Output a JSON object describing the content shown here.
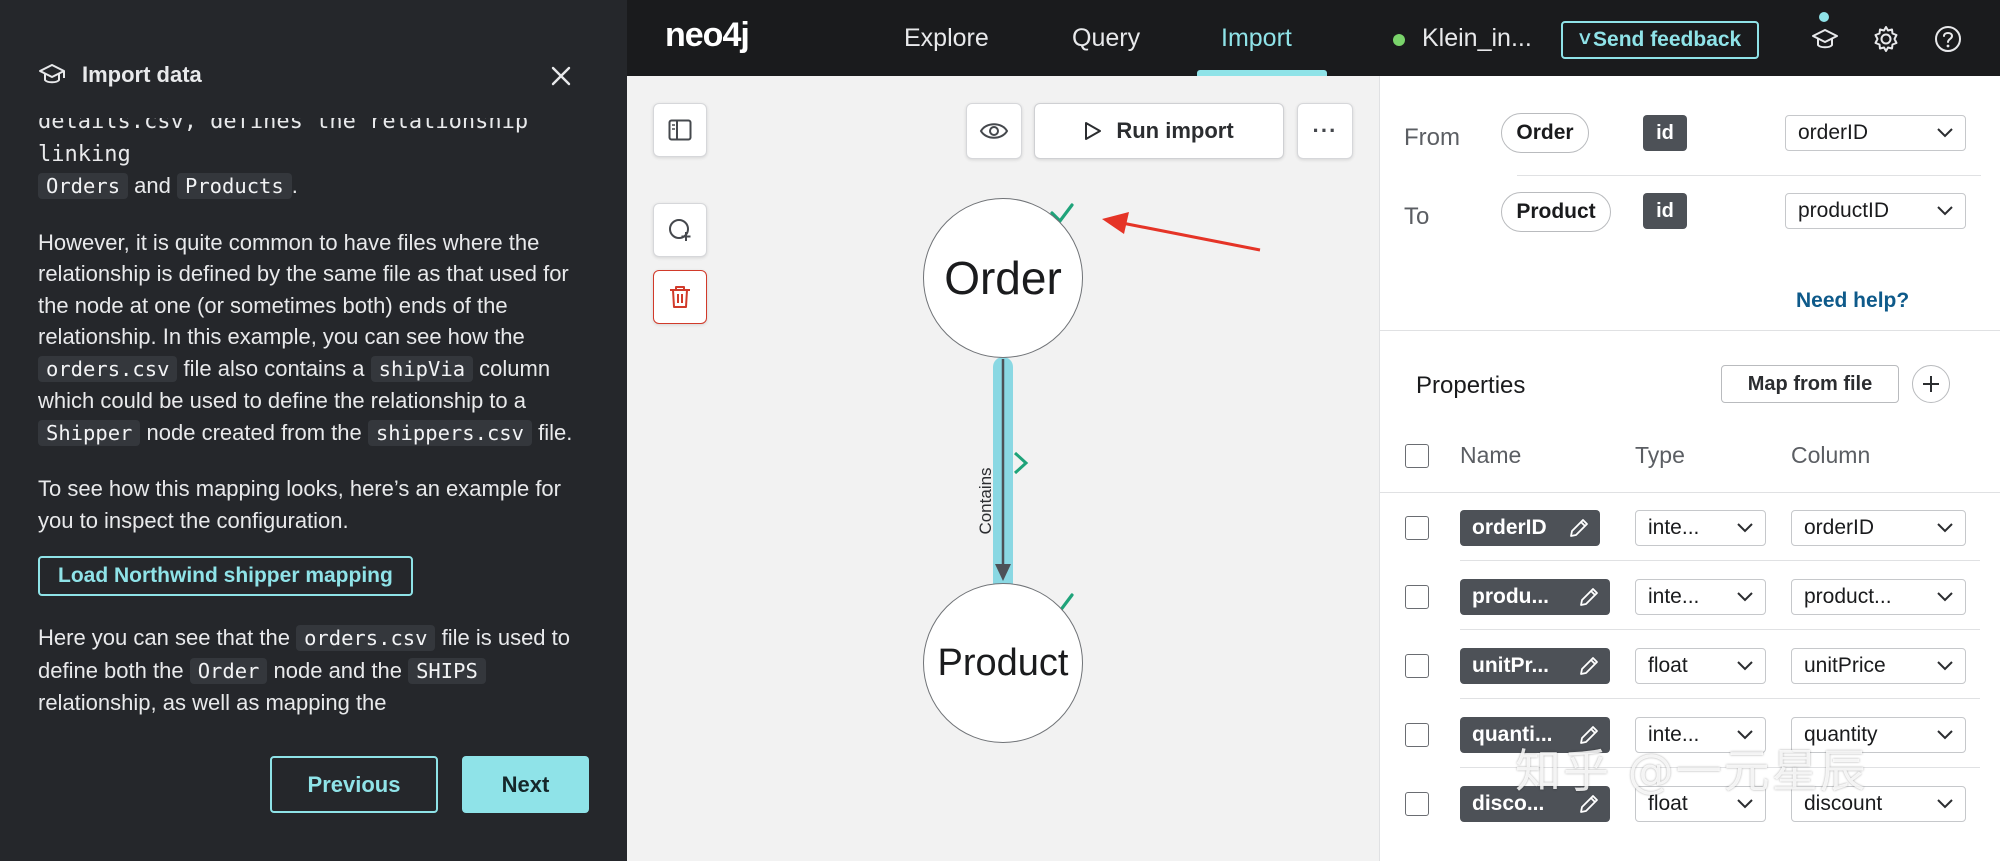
{
  "panel": {
    "title": "Import data",
    "cut_line": "details.csv, defines the relationship linking",
    "p1_parts": [
      "Orders",
      " and ",
      "Products",
      "."
    ],
    "p2_a": "However, it is quite common to have files where the relationship is defined by the same file as that used for the node at one (or sometimes both) ends of the relationship. In this example, you can see how the ",
    "p2_code1": "orders.csv",
    "p2_b": " file also contains a ",
    "p2_code2": "shipVia",
    "p2_c": " column which could be used to define the relationship to a ",
    "p2_code3": "Shipper",
    "p2_d": " node created from the ",
    "p2_code4": "shippers.csv",
    "p2_e": " file.",
    "p3": "To see how this mapping looks, here’s an example for you to inspect the configuration.",
    "load_button": "Load Northwind shipper mapping",
    "p4_a": "Here you can see that the ",
    "p4_code1": "orders.csv",
    "p4_b": " file is used to define both the ",
    "p4_code2": "Order",
    "p4_c": " node and the ",
    "p4_code3": "SHIPS",
    "p4_d": " relationship, as well as mapping the",
    "previous": "Previous",
    "next": "Next"
  },
  "nav": {
    "logo": "neo4j",
    "tabs": [
      "Explore",
      "Query",
      "Import"
    ],
    "active_tab": "Import",
    "db_name": "Klein_in...",
    "feedback": "Send feedback"
  },
  "canvas": {
    "run_import": "Run import",
    "nodes": [
      "Order",
      "Product"
    ],
    "relationship": "Contains"
  },
  "mapping": {
    "from_label": "From",
    "to_label": "To",
    "from_node": "Order",
    "to_node": "Product",
    "id_badge": "id",
    "from_column": "orderID",
    "to_column": "productID",
    "help": "Need help?"
  },
  "properties": {
    "title": "Properties",
    "map_from_file": "Map from file",
    "headers": [
      "Name",
      "Type",
      "Column"
    ],
    "rows": [
      {
        "name": "orderID",
        "type": "inte...",
        "column": "orderID"
      },
      {
        "name": "produ...",
        "type": "inte...",
        "column": "product..."
      },
      {
        "name": "unitPr...",
        "type": "float",
        "column": "unitPrice"
      },
      {
        "name": "quanti...",
        "type": "inte...",
        "column": "quantity"
      },
      {
        "name": "disco...",
        "type": "float",
        "column": "discount"
      }
    ]
  },
  "watermark": "知乎 @一元星辰",
  "colors": {
    "accent": "#8fe3e8",
    "success": "#1fa37a",
    "danger": "#d13a2a",
    "annotation": "#e53427"
  }
}
